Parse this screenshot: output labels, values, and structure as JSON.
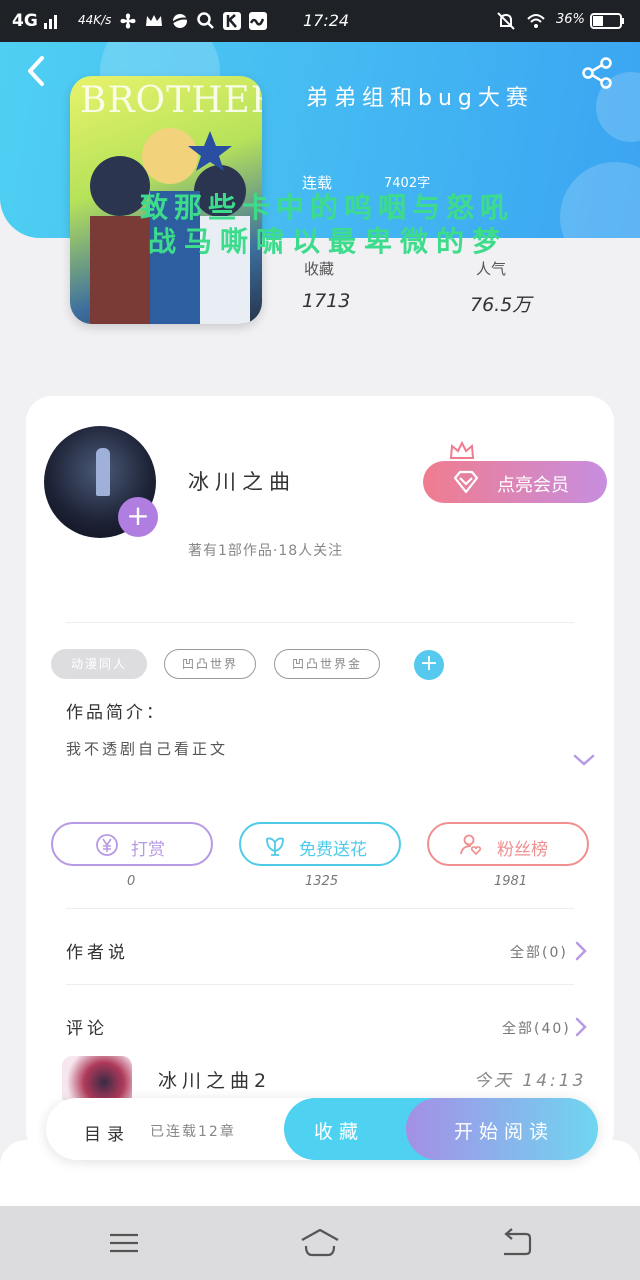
{
  "status_bar": {
    "network": "4G",
    "speed": "44K/s",
    "time": "17:24",
    "battery": "36%"
  },
  "book": {
    "cover_text": "BROTHER",
    "title": "弟弟组和bug大赛",
    "status_label": "连载",
    "word_count": "7402字",
    "overlay_line1": "致那些卡中的呜咽与怒吼",
    "overlay_line2": "战马嘶啸以最卑微的梦",
    "stats": [
      {
        "label": "收藏",
        "value": "1713"
      },
      {
        "label": "人气",
        "value": "76.5万"
      }
    ]
  },
  "author": {
    "name": "冰川之曲",
    "meta": "著有1部作品·18人关注",
    "vip_label": "点亮会员"
  },
  "tags": [
    "动漫同人",
    "凹凸世界",
    "凹凸世界金"
  ],
  "intro": {
    "title": "作品简介：",
    "text": "我不透剧自己看正文"
  },
  "actions": [
    {
      "label": "打赏",
      "count": "0",
      "color": "#b69ae3"
    },
    {
      "label": "免费送花",
      "count": "1325",
      "color": "#4fcbe9"
    },
    {
      "label": "粉丝榜",
      "count": "1981",
      "color": "#ef8f8f"
    }
  ],
  "author_says": {
    "title": "作者说",
    "right": "全部(0)"
  },
  "comments": {
    "title": "评论",
    "right": "全部(40)"
  },
  "comment": {
    "name": "冰川之曲2",
    "time": "今天 14:13"
  },
  "bottom_bar": {
    "toc": "目录",
    "toc_meta": "已连载12章",
    "collect": "收藏",
    "read": "开始阅读"
  },
  "colors": {
    "header_start": "#4fd0f2",
    "header_end": "#3ba4f2",
    "purple": "#b07ee0"
  }
}
